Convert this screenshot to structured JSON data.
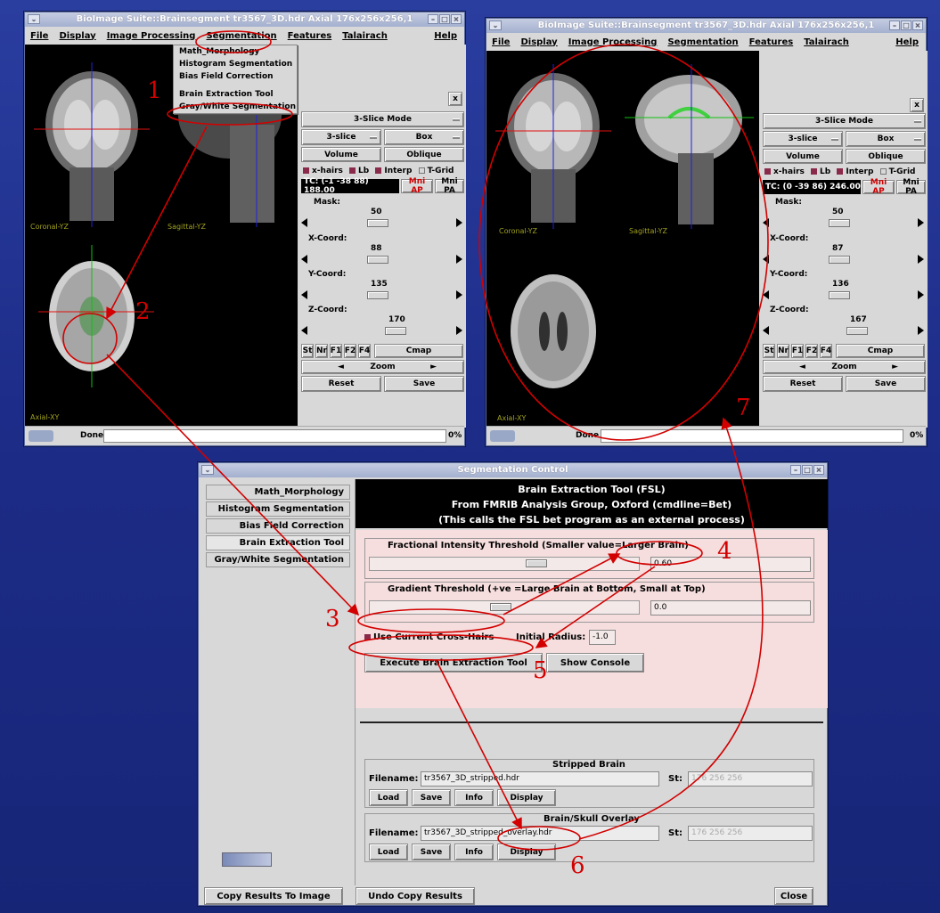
{
  "window_left": {
    "title": "BioImage Suite::Brainsegment tr3567_3D.hdr Axial 176x256x256,1",
    "menus": [
      "File",
      "Display",
      "Image Processing",
      "Segmentation",
      "Features",
      "Talairach"
    ],
    "help": "Help",
    "segmentation_menu": [
      "Math_Morphology",
      "Histogram Segmentation",
      "Bias Field Correction",
      "Brain Extraction Tool",
      "Gray/White Segmentation"
    ],
    "close_x": "x",
    "slice_mode": "3-Slice Mode",
    "mode": "3-slice",
    "box": "Box",
    "volume": "Volume",
    "oblique": "Oblique",
    "xhairs": "x-hairs",
    "lb": "Lb",
    "interp": "Interp",
    "tgrid": "T-Grid",
    "tc": "TC: (-1 -38 88) 188.00",
    "mni_ap": "Mni AP",
    "mni_pa": "Mni PA",
    "mask_label": "Mask:",
    "mask_value": "50",
    "x_label": "X-Coord:",
    "x_value": "88",
    "y_label": "Y-Coord:",
    "y_value": "135",
    "z_label": "Z-Coord:",
    "z_value": "170",
    "st": "St",
    "nr": "Nr",
    "f1": "F1",
    "f2": "F2",
    "f4": "F4",
    "cmap": "Cmap",
    "zoom": "Zoom",
    "reset": "Reset",
    "save": "Save",
    "status": "Done",
    "progress": "0%",
    "view_coronal": "Coronal-YZ",
    "view_sagittal": "Sagittal-YZ",
    "view_axial": "Axial-XY"
  },
  "window_right": {
    "title": "BioImage Suite::Brainsegment tr3567_3D.hdr Axial 176x256x256,1",
    "tc": "TC: (0 -39 86) 246.00",
    "mask_value": "50",
    "x_value": "87",
    "y_value": "136",
    "z_value": "167",
    "status": "Done",
    "progress": "0%"
  },
  "seg_window": {
    "title": "Segmentation Control",
    "sidebar": [
      "Math_Morphology",
      "Histogram Segmentation",
      "Bias Field Correction",
      "Brain Extraction Tool",
      "Gray/White Segmentation"
    ],
    "header_line1": "Brain Extraction Tool  (FSL)",
    "header_line2": "From FMRIB Analysis Group, Oxford (cmdline=Bet)",
    "header_line3": "(This calls the FSL bet program as an external process)",
    "fit_label": "Fractional Intensity Threshold (Smaller value=Larger Brain)",
    "fit_value": "0.60",
    "grad_label": "Gradient Threshold (+ve =Large Brain at Bottom, Small at Top)",
    "grad_value": "0.0",
    "use_xhairs": "Use Current Cross-Hairs",
    "radius_label": "Initial Radius:",
    "radius_value": "-1.0",
    "execute": "Execute Brain Extraction Tool",
    "show_console": "Show Console",
    "stripped_title": "Stripped Brain",
    "filename_label": "Filename:",
    "stripped_filename": "tr3567_3D_stripped.hdr",
    "st_label": "St:",
    "dims": "176 256 256",
    "load": "Load",
    "save": "Save",
    "info": "Info",
    "display": "Display",
    "overlay_title": "Brain/Skull Overlay",
    "overlay_filename": "tr3567_3D_stripped_overlay.hdr",
    "copy_results": "Copy Results To Image",
    "undo_copy": "Undo Copy Results",
    "close": "Close"
  },
  "annotations": [
    "1",
    "2",
    "3",
    "4",
    "5",
    "6",
    "7"
  ],
  "colors": {
    "annotation": "#d20000",
    "crosshair_red": "#e01010",
    "crosshair_green": "#10c010",
    "crosshair_blue": "#2020e0"
  }
}
